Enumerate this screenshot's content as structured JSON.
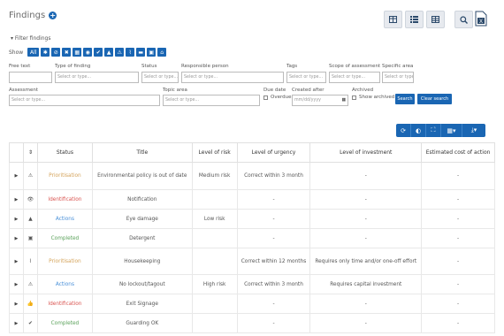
{
  "header": {
    "title": "Findings"
  },
  "filter": {
    "toggle_label": "▾ Filter findings",
    "show_label": "Show",
    "all_label": "All"
  },
  "fields": {
    "free_text": {
      "label": "Free text",
      "placeholder": ""
    },
    "type": {
      "label": "Type of finding",
      "placeholder": "Select or type..."
    },
    "status": {
      "label": "Status",
      "placeholder": "Select or type..."
    },
    "responsible": {
      "label": "Responsible person",
      "placeholder": "Select or type..."
    },
    "tags": {
      "label": "Tags",
      "placeholder": "Select or type..."
    },
    "scope": {
      "label": "Scope of assessment",
      "placeholder": "Select or type..."
    },
    "specific_area": {
      "label": "Specific area",
      "placeholder": "Select or type..."
    },
    "assessment": {
      "label": "Assessment",
      "placeholder": "Select or type..."
    },
    "topic_area": {
      "label": "Topic area",
      "placeholder": "Select or type..."
    },
    "due_date": {
      "label": "Due date",
      "overdue_label": "Overdue"
    },
    "created_after": {
      "label": "Created after",
      "placeholder": "mm/dd/yyyy"
    },
    "archived": {
      "label": "Archived",
      "show_label": "Show archived"
    }
  },
  "buttons": {
    "search": "Search",
    "clear": "Clear search"
  },
  "table": {
    "headers": [
      "",
      "",
      "Status",
      "Title",
      "Level of risk",
      "Level of urgency",
      "Level of investment",
      "Estimated cost of action"
    ],
    "rows": [
      {
        "icon": "⚠",
        "status": "Prioritisation",
        "title": "Environmental policy is out of date",
        "risk": "Medium risk",
        "urgency": "Correct within 3 month",
        "investment": "-",
        "cost": "-"
      },
      {
        "icon": "👁",
        "status": "Identification",
        "title": "Notification",
        "risk": "",
        "urgency": "-",
        "investment": "-",
        "cost": "-"
      },
      {
        "icon": "▲",
        "status": "Actions",
        "title": "Eye damage",
        "risk": "Low risk",
        "urgency": "-",
        "investment": "-",
        "cost": "-"
      },
      {
        "icon": "▣",
        "status": "Completed",
        "title": "Detergent",
        "risk": "",
        "urgency": "-",
        "investment": "-",
        "cost": "-"
      },
      {
        "icon": "⌇",
        "status": "Prioritisation",
        "title": "Housekeeping",
        "risk": "",
        "urgency": "Correct within 12 months",
        "investment": "Requires only time and/or one-off effort",
        "cost": "-"
      },
      {
        "icon": "⚠",
        "status": "Actions",
        "title": "No lockout/tagout",
        "risk": "High risk",
        "urgency": "Correct within 3 month",
        "investment": "Requires capital investment",
        "cost": "-"
      },
      {
        "icon": "👍",
        "status": "Identification",
        "title": "Exit Signage",
        "risk": "",
        "urgency": "-",
        "investment": "-",
        "cost": "-"
      },
      {
        "icon": "✔",
        "status": "Completed",
        "title": "Guarding OK",
        "risk": "",
        "urgency": "-",
        "investment": "-",
        "cost": "-"
      }
    ]
  },
  "colors": {
    "accent": "#1a66b3"
  }
}
